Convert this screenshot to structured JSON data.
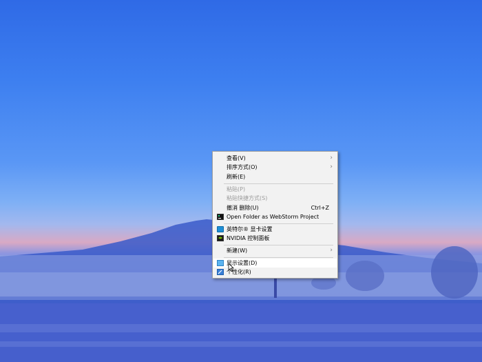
{
  "desktop": {
    "wallpaper": "Mountain with mist at dusk",
    "colors": {
      "sky_top": "#2f6ae6",
      "sky_horizon": "#d9a9c4",
      "ground": "#3b50b6"
    }
  },
  "context_menu": {
    "items": [
      {
        "label": "查看(V)",
        "has_submenu": true
      },
      {
        "label": "排序方式(O)",
        "has_submenu": true
      },
      {
        "label": "刷新(E)"
      },
      {
        "label": "粘贴(P)",
        "disabled": true
      },
      {
        "label": "粘贴快捷方式(S)",
        "disabled": true
      },
      {
        "label": "撤消 删除(U)",
        "shortcut": "Ctrl+Z"
      },
      {
        "label": "Open Folder as WebStorm Project",
        "icon": "webstorm-icon"
      },
      {
        "label": "英特尔® 显卡设置",
        "icon": "intel-graphics-icon"
      },
      {
        "label": "NVIDIA 控制面板",
        "icon": "nvidia-icon"
      },
      {
        "label": "新建(W)",
        "has_submenu": true
      },
      {
        "label": "显示设置(D)",
        "icon": "display-settings-icon",
        "highlighted": true
      },
      {
        "label": "个性化(R)",
        "icon": "personalize-icon"
      }
    ]
  }
}
